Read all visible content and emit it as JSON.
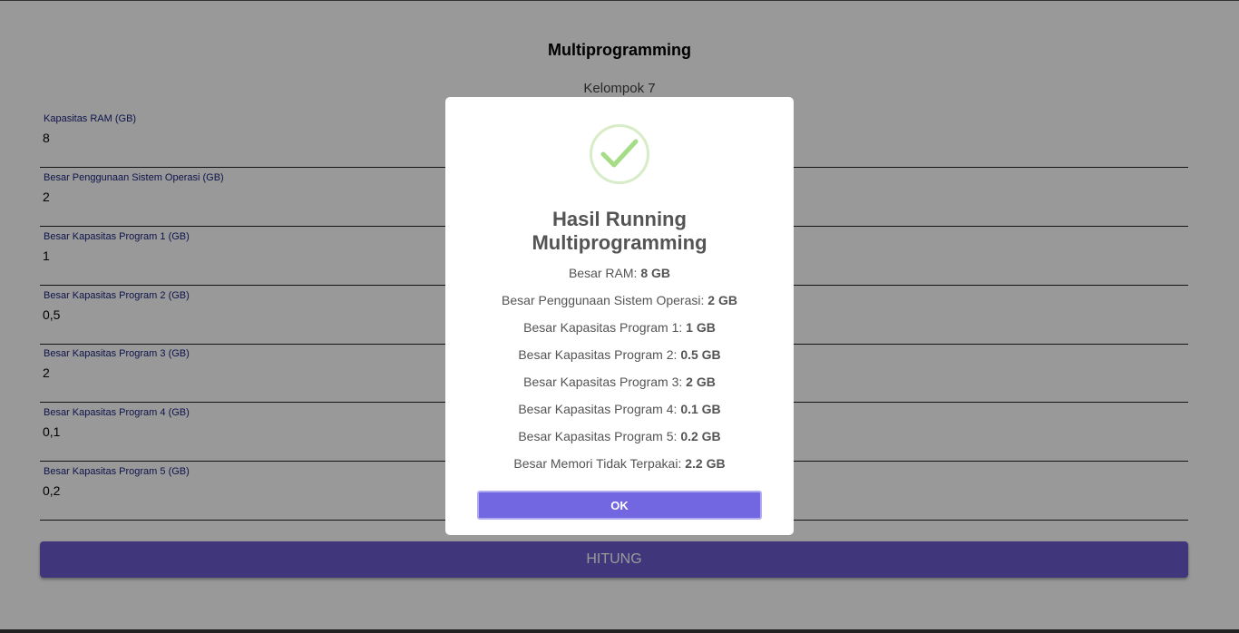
{
  "page": {
    "title": "Multiprogramming",
    "subtitle": "Kelompok 7"
  },
  "form": {
    "fields": [
      {
        "label": "Kapasitas RAM (GB)",
        "value": "8"
      },
      {
        "label": "Besar Penggunaan Sistem Operasi (GB)",
        "value": "2"
      },
      {
        "label": "Besar Kapasitas Program 1 (GB)",
        "value": "1"
      },
      {
        "label": "Besar Kapasitas Program 2 (GB)",
        "value": "0,5"
      },
      {
        "label": "Besar Kapasitas Program 3 (GB)",
        "value": "2"
      },
      {
        "label": "Besar Kapasitas Program 4 (GB)",
        "value": "0,1"
      },
      {
        "label": "Besar Kapasitas Program 5 (GB)",
        "value": "0,2"
      }
    ],
    "submit_label": "HITUNG"
  },
  "modal": {
    "icon": "checkmark-icon",
    "title": "Hasil Running Multiprogramming",
    "results": [
      {
        "label": "Besar RAM: ",
        "value": "8 GB"
      },
      {
        "label": "Besar Penggunaan Sistem Operasi: ",
        "value": "2 GB"
      },
      {
        "label": "Besar Kapasitas Program 1: ",
        "value": "1 GB"
      },
      {
        "label": "Besar Kapasitas Program 2: ",
        "value": "0.5 GB"
      },
      {
        "label": "Besar Kapasitas Program 3: ",
        "value": "2 GB"
      },
      {
        "label": "Besar Kapasitas Program 4: ",
        "value": "0.1 GB"
      },
      {
        "label": "Besar Kapasitas Program 5: ",
        "value": "0.2 GB"
      },
      {
        "label": "Besar Memori Tidak Terpakai: ",
        "value": "2.2 GB"
      }
    ],
    "ok_label": "OK"
  },
  "colors": {
    "accent": "#6a5acd",
    "ok_button": "#7267e0",
    "success": "#a5dc86"
  }
}
